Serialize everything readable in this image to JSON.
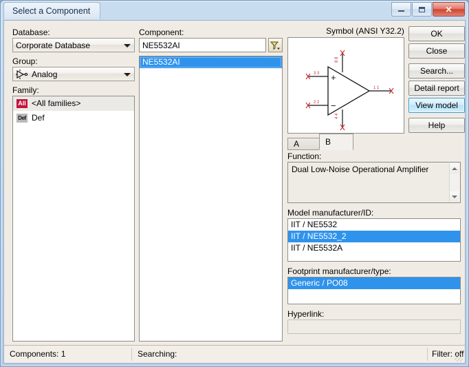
{
  "window": {
    "title": "Select a Component",
    "buttons": {
      "minimize": "minimize",
      "maximize": "maximize",
      "close": "✕"
    }
  },
  "left_panel": {
    "database_label": "Database:",
    "database_value": "Corporate Database",
    "group_label": "Group:",
    "group_value": "Analog",
    "group_icon": "opamp-icon",
    "family_label": "Family:",
    "family_items": [
      {
        "badge": "All",
        "label": "<All families>",
        "state": "selected-inactive"
      },
      {
        "badge": "Def",
        "label": "Def",
        "state": "normal"
      }
    ]
  },
  "center_panel": {
    "component_label": "Component:",
    "component_value": "NE5532AI",
    "component_placeholder": "",
    "filter_button_icon": "filter-funnel-icon",
    "component_items": [
      {
        "label": "NE5532AI",
        "state": "selected-focused"
      }
    ]
  },
  "symbol_panel": {
    "title": "Symbol (ANSI Y32.2)",
    "symbol_type": "operational-amplifier",
    "pin_markers": [
      "+",
      "−"
    ],
    "tabs": [
      {
        "label": "A",
        "active": false
      },
      {
        "label": "B",
        "active": true
      }
    ]
  },
  "details": {
    "function_label": "Function:",
    "function_value": "Dual Low-Noise Operational Amplifier",
    "model_label": "Model manufacturer/ID:",
    "model_items": [
      {
        "label": "IIT / NE5532",
        "state": "normal"
      },
      {
        "label": "IIT / NE5532_2",
        "state": "selected"
      },
      {
        "label": "IIT / NE5532A",
        "state": "normal"
      }
    ],
    "footprint_label": "Footprint manufacturer/type:",
    "footprint_items": [
      {
        "label": "Generic / PO08",
        "state": "selected"
      }
    ],
    "hyperlink_label": "Hyperlink:",
    "hyperlink_value": ""
  },
  "actions": {
    "ok": "OK",
    "close": "Close",
    "search": "Search...",
    "detail_report": "Detail report",
    "view_model": "View model",
    "help": "Help"
  },
  "statusbar": {
    "components": "Components: 1",
    "searching": "Searching:",
    "filter": "Filter: off"
  },
  "colors": {
    "selection_blue": "#2f93ec",
    "title_bar": "#c9ddf0",
    "dialog_bg": "#f0ece5",
    "badge_all": "#c3143c",
    "hover_button": "#b7e2fa",
    "symbol_pin_red": "#c23030"
  }
}
